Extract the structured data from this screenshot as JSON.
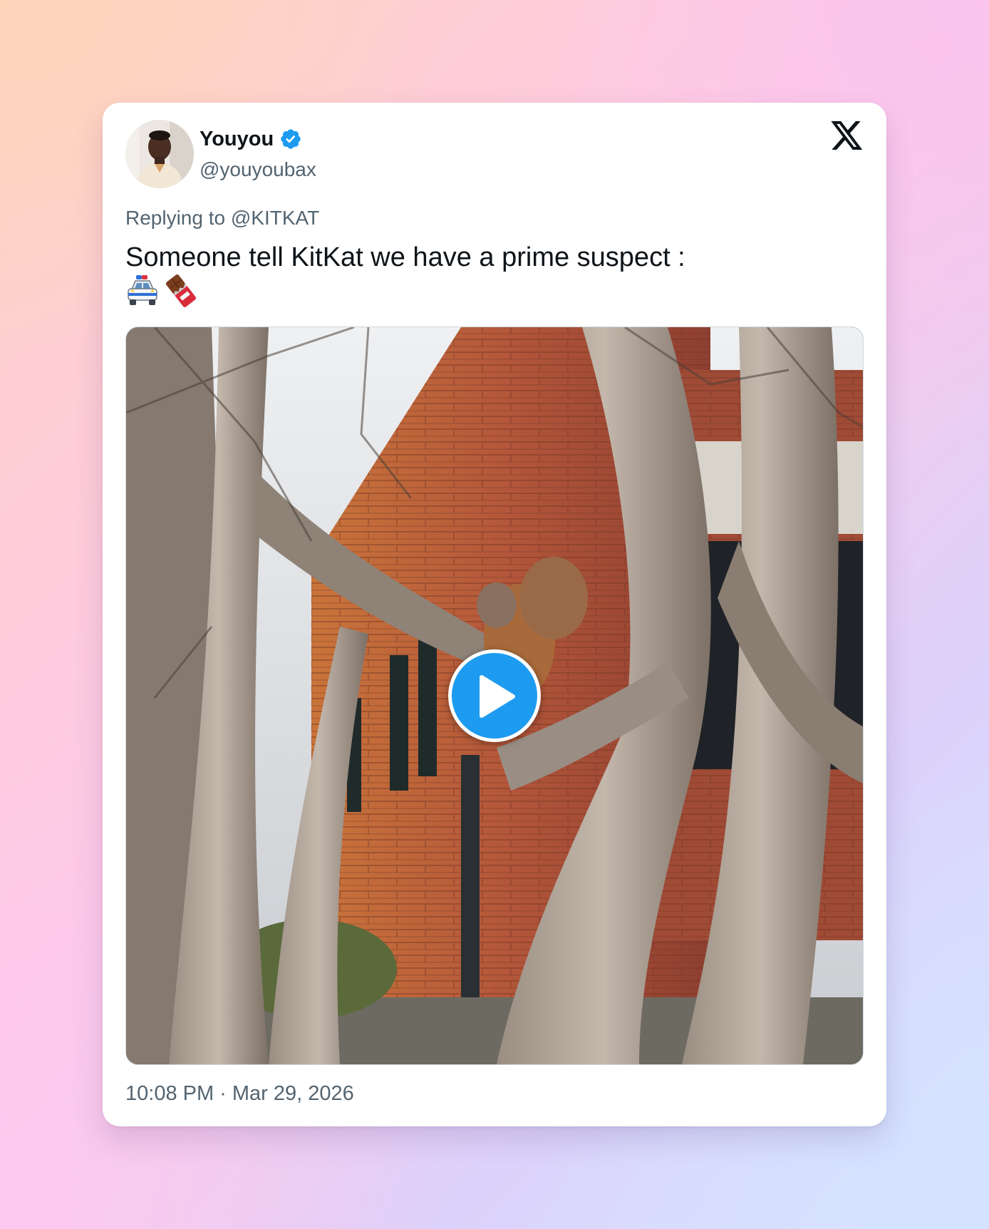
{
  "author": {
    "display_name": "Youyou",
    "handle": "@youyoubax",
    "verified": true,
    "avatar_icon": "profile-photo"
  },
  "platform_icon": "x-logo-icon",
  "reply": {
    "text": "Replying to @KITKAT"
  },
  "tweet": {
    "text": "Someone tell KitKat we have a prime suspect :",
    "emojis": [
      "police-car-emoji",
      "chocolate-bar-emoji"
    ]
  },
  "media": {
    "type": "video",
    "description_icon": "video-thumbnail",
    "play_icon": "play-icon"
  },
  "timestamp": "10:08 PM · Mar 29, 2026",
  "colors": {
    "accent": "#1d9bf0",
    "text_primary": "#0f1419",
    "text_secondary": "#536471"
  }
}
